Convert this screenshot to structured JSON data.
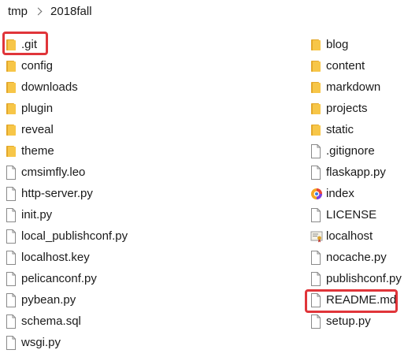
{
  "breadcrumb": {
    "root": "tmp",
    "current": "2018fall"
  },
  "left_column": [
    {
      "name": ".git",
      "icon": "folder-icon",
      "highlighted": true
    },
    {
      "name": "config",
      "icon": "folder-icon"
    },
    {
      "name": "downloads",
      "icon": "folder-icon"
    },
    {
      "name": "plugin",
      "icon": "folder-icon"
    },
    {
      "name": "reveal",
      "icon": "folder-icon"
    },
    {
      "name": "theme",
      "icon": "folder-icon"
    },
    {
      "name": "cmsimfly.leo",
      "icon": "file-icon"
    },
    {
      "name": "http-server.py",
      "icon": "file-icon"
    },
    {
      "name": "init.py",
      "icon": "file-icon"
    },
    {
      "name": "local_publishconf.py",
      "icon": "file-icon"
    },
    {
      "name": "localhost.key",
      "icon": "file-icon"
    },
    {
      "name": "pelicanconf.py",
      "icon": "file-icon"
    },
    {
      "name": "pybean.py",
      "icon": "file-icon"
    },
    {
      "name": "schema.sql",
      "icon": "file-icon"
    },
    {
      "name": "wsgi.py",
      "icon": "file-icon"
    }
  ],
  "right_column": [
    {
      "name": "blog",
      "icon": "folder-icon"
    },
    {
      "name": "content",
      "icon": "folder-icon"
    },
    {
      "name": "markdown",
      "icon": "folder-icon"
    },
    {
      "name": "projects",
      "icon": "folder-icon"
    },
    {
      "name": "static",
      "icon": "folder-icon"
    },
    {
      "name": ".gitignore",
      "icon": "file-icon"
    },
    {
      "name": "flaskapp.py",
      "icon": "file-icon"
    },
    {
      "name": "index",
      "icon": "browser-icon"
    },
    {
      "name": "LICENSE",
      "icon": "file-icon"
    },
    {
      "name": "localhost",
      "icon": "certificate-icon"
    },
    {
      "name": "nocache.py",
      "icon": "file-icon"
    },
    {
      "name": "publishconf.py",
      "icon": "file-icon"
    },
    {
      "name": "README.md",
      "icon": "file-icon",
      "highlighted": true
    },
    {
      "name": "setup.py",
      "icon": "file-icon"
    }
  ],
  "colors": {
    "folder": "#f7c648",
    "folder_dark": "#e3a82b",
    "highlight": "#e0353a",
    "file_border": "#8a8a8a"
  }
}
